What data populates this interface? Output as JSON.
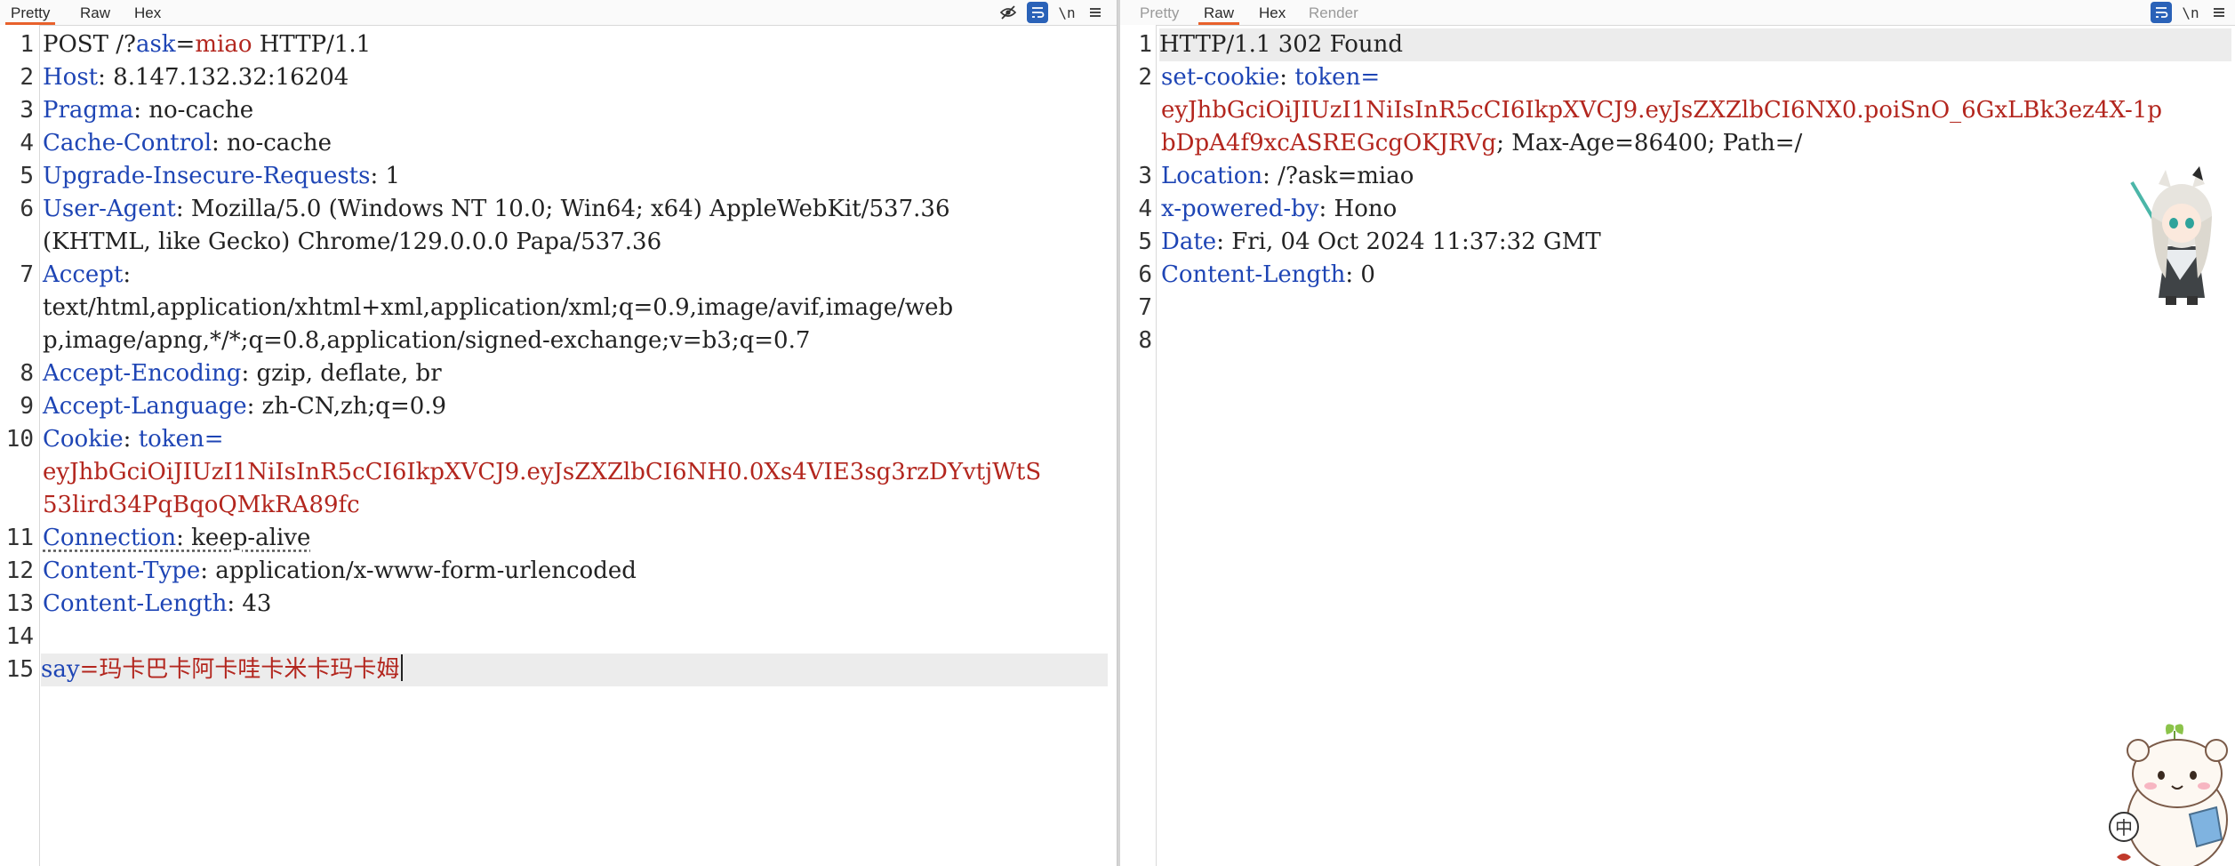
{
  "request": {
    "tabs": [
      "Pretty",
      "Raw",
      "Hex"
    ],
    "active_tab": "Pretty",
    "toolbar": {
      "hide_icon": "eye-off-icon",
      "wrap_icon": "wrap-lines-icon",
      "newline_label": "\\n",
      "menu_icon": "hamburger-menu-icon"
    },
    "line_numbers": [
      "1",
      "2",
      "3",
      "4",
      "5",
      "6",
      "7",
      "8",
      "9",
      "10",
      "11",
      "12",
      "13",
      "14",
      "15"
    ],
    "lines": {
      "l1": "POST /?",
      "l1_key": "ask",
      "l1_eq": "=",
      "l1_val": "miao",
      "l1_tail": " HTTP/1.1",
      "l2_key": "Host",
      "l2_val": ": 8.147.132.32:16204",
      "l3_key": "Pragma",
      "l3_val": ": no-cache",
      "l4_key": "Cache-Control",
      "l4_val": ": no-cache",
      "l5_key": "Upgrade-Insecure-Requests",
      "l5_val": ": 1",
      "l6_key": "User-Agent",
      "l6_val_a": ": Mozilla/5.0 (Windows NT 10.0; Win64; x64) AppleWebKit/537.36",
      "l6_val_b": "(KHTML, like Gecko) Chrome/129.0.0.0 Papa/537.36",
      "l7_key": "Accept",
      "l7_colon": ":",
      "l7_val_a": "text/html,application/xhtml+xml,application/xml;q=0.9,image/avif,image/web",
      "l7_val_b": "p,image/apng,*/*;q=0.8,application/signed-exchange;v=b3;q=0.7",
      "l8_key": "Accept-Encoding",
      "l8_val": ": gzip, deflate, br",
      "l9_key": "Accept-Language",
      "l9_val": ": zh-CN,zh;q=0.9",
      "l10_key": "Cookie",
      "l10_colon": ": ",
      "l10_cookie_name": "token",
      "l10_eq": "=",
      "l10_val_a": "eyJhbGciOiJIUzI1NiIsInR5cCI6IkpXVCJ9.eyJsZXZlbCI6NH0.0Xs4VIE3sg3rzDYvtjWtS",
      "l10_val_b": "53lird34PqBqoQMkRA89fc",
      "l11_key": "Connection",
      "l11_val": ": keep-alive",
      "l12_key": "Content-Type",
      "l12_val": ": application/x-www-form-urlencoded",
      "l13_key": "Content-Length",
      "l13_val": ": 43",
      "l15_key": "say",
      "l15_eq": "=",
      "l15_val": "玛卡巴卡阿卡哇卡米卡玛卡姆"
    }
  },
  "response": {
    "tabs": [
      "Pretty",
      "Raw",
      "Hex",
      "Render"
    ],
    "active_tab": "Raw",
    "toolbar": {
      "wrap_icon": "wrap-lines-icon",
      "newline_label": "\\n",
      "menu_icon": "hamburger-menu-icon"
    },
    "line_numbers": [
      "1",
      "2",
      "3",
      "4",
      "5",
      "6",
      "7",
      "8"
    ],
    "lines": {
      "l1": "HTTP/1.1 302 Found",
      "l2_key": "set-cookie",
      "l2_colon": ": ",
      "l2_cookie_name": "token",
      "l2_eq": "=",
      "l2_val_a": "eyJhbGciOiJIUzI1NiIsInR5cCI6IkpXVCJ9.eyJsZXZlbCI6NX0.poiSnO_6GxLBk3ez4X-1p",
      "l2_val_b": "bDpA4f9xcASREGcgOKJRVg",
      "l2_tail": "; Max-Age=86400; Path=/",
      "l3_key": "Location",
      "l3_val": ": /?ask=miao",
      "l4_key": "x-powered-by",
      "l4_val": ": Hono",
      "l5_key": "Date",
      "l5_val": ": Fri, 04 Oct 2024 11:37:32 GMT",
      "l6_key": "Content-Length",
      "l6_val": ": 0"
    }
  },
  "overlay": {
    "ime_label": "中"
  },
  "colors": {
    "header_key": "#1e45b5",
    "red_value": "#b3261e",
    "accent_tab": "#e8612c",
    "toolbar_blue": "#2a62b8"
  }
}
